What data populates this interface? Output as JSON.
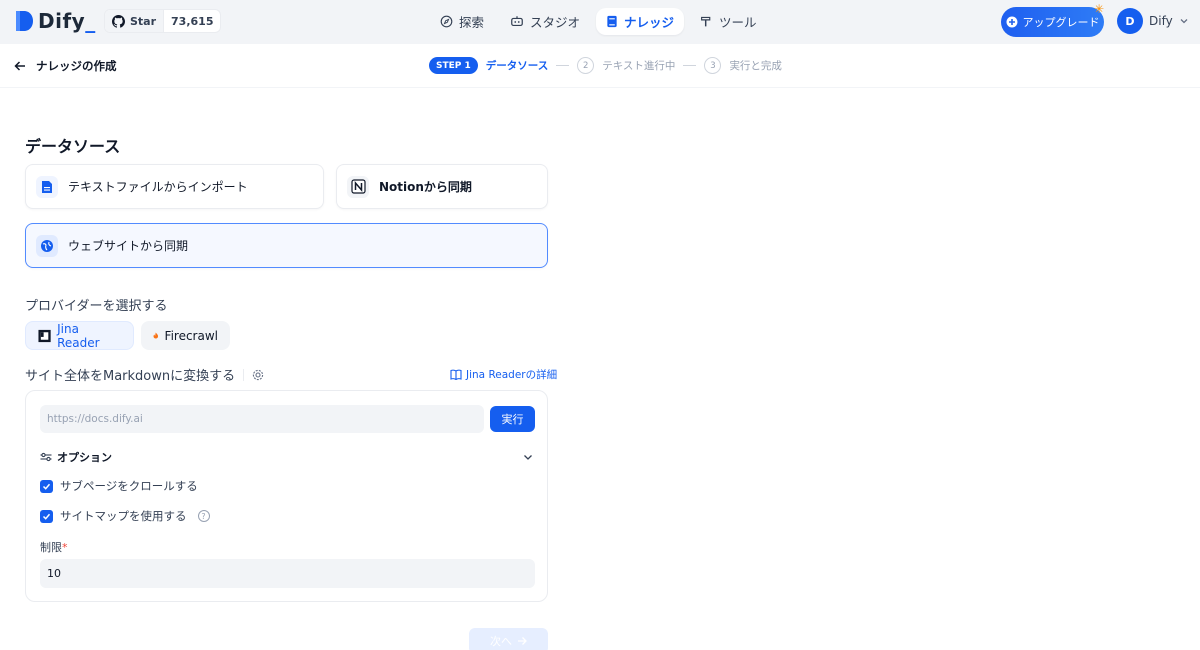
{
  "app": {
    "logo_text": "Dify",
    "github": {
      "star_label": "Star",
      "star_count": "73,615"
    }
  },
  "nav": {
    "items": [
      {
        "label": "探索",
        "icon": "compass-icon"
      },
      {
        "label": "スタジオ",
        "icon": "robot-icon"
      },
      {
        "label": "ナレッジ",
        "icon": "book-icon",
        "active": true
      },
      {
        "label": "ツール",
        "icon": "hammer-icon"
      }
    ]
  },
  "upgrade_label": "アップグレード",
  "user": {
    "initial": "D",
    "name": "Dify"
  },
  "page": {
    "title": "ナレッジの作成"
  },
  "steps": {
    "step1_badge": "STEP 1",
    "step1_label": "データソース",
    "step2_num": "2",
    "step2_label": "テキスト進行中",
    "step3_num": "3",
    "step3_label": "実行と完成"
  },
  "datasource": {
    "title": "データソース",
    "options": [
      {
        "label": "テキストファイルからインポート",
        "icon": "file-text-icon"
      },
      {
        "label": "Notionから同期",
        "icon": "notion-icon"
      },
      {
        "label": "ウェブサイトから同期",
        "icon": "globe-icon",
        "selected": true
      }
    ]
  },
  "provider": {
    "title": "プロバイダーを選択する",
    "options": [
      {
        "label": "Jina Reader",
        "active": true
      },
      {
        "label": "Firecrawl",
        "active": false
      }
    ]
  },
  "crawl": {
    "title": "サイト全体をMarkdownに変換する",
    "doc_link": "Jina Readerの詳細",
    "url_placeholder": "https://docs.dify.ai",
    "run_label": "実行",
    "options_label": "オプション",
    "crawl_subpages_label": "サブページをクロールする",
    "crawl_subpages_checked": true,
    "use_sitemap_label": "サイトマップを使用する",
    "use_sitemap_checked": true,
    "limit_label": "制限",
    "limit_required_mark": "*",
    "limit_value": "10"
  },
  "next_label": "次へ",
  "colors": {
    "accent": "#155eef",
    "nav_bg": "#f2f4f7",
    "required": "#f04438"
  }
}
